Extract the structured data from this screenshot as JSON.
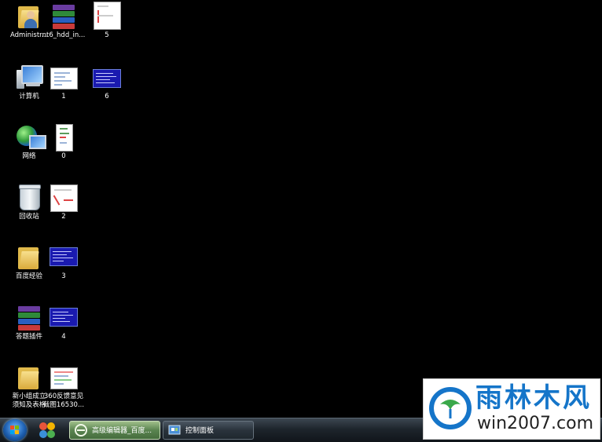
{
  "desktop": {
    "icons": {
      "administrator": "Administr...",
      "nt6": "nt6_hdd_in...",
      "file5": "5",
      "computer": "计算机",
      "file1": "1",
      "file6": "6",
      "network": "网络",
      "file0": "0",
      "recycle": "回收站",
      "file2": "2",
      "baidu": "百度经验",
      "file3": "3",
      "plugin": "答题插件",
      "file4": "4",
      "newgroup": "新小组成立\n须知及表格",
      "screenshot": "360反馈意见\n截图16530..."
    }
  },
  "taskbar": {
    "tasks": [
      {
        "label": "高级编辑器_百度...",
        "active": true
      },
      {
        "label": "控制面板",
        "active": false
      }
    ]
  },
  "watermark": {
    "brand": "雨林木风",
    "url": "win2007.com"
  }
}
